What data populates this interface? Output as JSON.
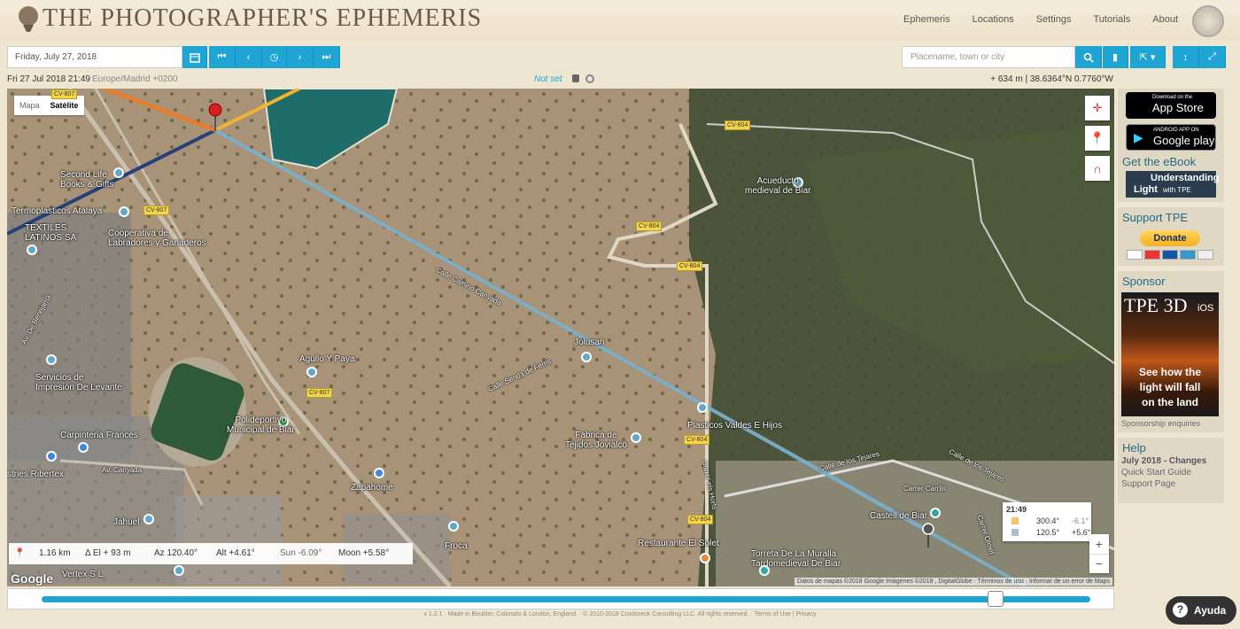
{
  "header": {
    "title": "THE PHOTOGRAPHER'S EPHEMERIS",
    "nav": [
      "Ephemeris",
      "Locations",
      "Settings",
      "Tutorials",
      "About"
    ]
  },
  "toolbar": {
    "date_value": "Friday, July 27, 2018",
    "search_placeholder": "Placename, town or city"
  },
  "inforow": {
    "datetime": "Fri 27 Jul 2018 21:49",
    "timezone": "Europe/Madrid +0200",
    "not_set": "Not set",
    "coords": "+ 634 m | 38.6364°N 0.7760°W"
  },
  "map": {
    "type_tabs": [
      "Mapa",
      "Satélite"
    ],
    "labels": {
      "second_life": "Second Life\nBooks & Gifts",
      "termoplasticos": "Termoplasticos Atalaya",
      "textiles": "TEXTILES\nLATINOS SA",
      "cooperativa": "Cooperativa de\nLabradores y Ganaderos",
      "acueducto": "Acueducto\nmedieval de Biar",
      "calle_camino": "Calle Camino Canyada",
      "jolusan": "Jolusan",
      "calle_senda": "Calle Senda de Ferris",
      "agullo": "Agullo Y Paya",
      "av_benejama": "Av. De Benejama",
      "servicios": "Servicios de\nImpresión De Levante",
      "polideportivo": "Polideportivo\nMunicipal de Biar",
      "carpinteria": "Carpinteria Frances",
      "av_canyada": "Av. Canyada",
      "ribertex": "stries Ribertex",
      "fabrica": "Fabrica de\nTejidos Jovialco",
      "plasticos": "Plasticos Valdes E Hijos",
      "calle_tejares": "Calle de los Tejares",
      "carrer_carrils": "Carrer Carrils",
      "carrer_horts": "Carrer els Horts",
      "calle_tejares2": "Calle de los Tejares",
      "carrer_olmet": "Carrer Olmet",
      "castell": "Castell de Biar",
      "zapahome": "Zapahome",
      "jahuel": "Jahuel",
      "restaurante": "Restaurante El Solet",
      "torreta": "Torreta De La Muralla\nTardomedieval De Biar",
      "froca": "Froca",
      "vertex": "Vertex S L"
    },
    "roads": {
      "cv807a": "CV-807",
      "cv807b": "CV-807",
      "cv807c": "CV-807",
      "cv804a": "CV-804",
      "cv804b": "CV-804",
      "cv804c": "CV-804",
      "cv804d": "CV-804",
      "cv804e": "CV-804"
    },
    "stats": {
      "distance": "1.16 km",
      "delta_el": "Δ El + 93 m",
      "azimuth": "Az 120.40°",
      "altitude": "Alt +4.61°",
      "sun": "Sun -6.09°",
      "moon": "Moon +5.58°"
    },
    "google": "Google",
    "attribution": "Datos de mapas ©2018 Google Imágenes ©2018 , DigitalGlobe · Términos de uso · Informar de un error de Maps",
    "popup": {
      "time": "21:49",
      "row1_az": "300.4°",
      "row1_alt": "-6.1°",
      "row2_az": "120.5°",
      "row2_alt": "+5.6°"
    },
    "zoom_in": "+",
    "zoom_out": "−"
  },
  "slider": {
    "value": 0.91
  },
  "footer": {
    "text": "v 1.2.1 · Made in Boulder, Colorado & London, England. · © 2010-2018 Crookneck Consulting LLC. All rights reserved. · ",
    "terms": "Terms of Use",
    "privacy": "Privacy"
  },
  "sidebar": {
    "appstore_small": "Download on the",
    "appstore_big": "App Store",
    "play_small": "ANDROID APP ON",
    "play_big": "Google play",
    "ebook_title": "Get the eBook",
    "ebook_line1": "Understanding",
    "ebook_line2": "Light",
    "ebook_line3": "with TPE",
    "support_title": "Support TPE",
    "donate": "Donate",
    "sponsor_title": "Sponsor",
    "sponsor_big": "TPE 3D",
    "sponsor_ios": "iOS",
    "sponsor_text": "See how the\nlight will fall\non the land",
    "sponsor_link": "Sponsorship enquiries",
    "help_title": "Help",
    "help_links": [
      "July 2018 - Changes",
      "Quick Start Guide",
      "Support Page"
    ]
  },
  "help_fab": "Ayuda"
}
